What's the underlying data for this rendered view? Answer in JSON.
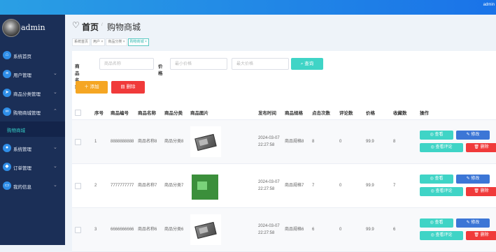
{
  "topbar": {
    "user": "admin"
  },
  "sidebar": {
    "brand": "admin",
    "items": [
      {
        "label": "系统首页",
        "icon": "home-icon",
        "chevron": false
      },
      {
        "label": "用户管理",
        "icon": "menu-list-icon",
        "chevron": true
      },
      {
        "label": "商品分类管理",
        "icon": "send-icon",
        "chevron": true
      },
      {
        "label": "购物商城管理",
        "icon": "link-icon",
        "chevron": true,
        "expanded": true
      },
      {
        "label": "系统管理",
        "icon": "person-icon",
        "chevron": true
      },
      {
        "label": "订单管理",
        "icon": "shield-icon",
        "chevron": true
      },
      {
        "label": "我的信息",
        "icon": "card-icon",
        "chevron": true
      }
    ],
    "sub_item": "购物商城"
  },
  "header": {
    "home": "首页",
    "separator": "/",
    "current": "购物商城"
  },
  "tags": [
    {
      "label": "系统首页",
      "active": false
    },
    {
      "label": "用户 ×",
      "active": false
    },
    {
      "label": "商品分类 ×",
      "active": false
    },
    {
      "label": "购物商城 ×",
      "active": true
    }
  ],
  "search": {
    "name_label": "商品名称",
    "name_placeholder": "商品名称",
    "price_label": "价格",
    "min_placeholder": "最小价格",
    "max_placeholder": "最大价格",
    "query_button": "查询"
  },
  "actions": {
    "add": "添加",
    "delete": "删除"
  },
  "table": {
    "headers": [
      "",
      "序号",
      "商品编号",
      "商品名称",
      "商品分类",
      "商品图片",
      "发布时间",
      "商品规格",
      "点击次数",
      "评论数",
      "价格",
      "收藏数",
      "操作"
    ],
    "rows": [
      {
        "index": "1",
        "code": "8888888888",
        "name": "商品名称8",
        "category": "商品分类8",
        "image": "chip",
        "time": "2024-03-07 22:27:58",
        "spec": "商品规格8",
        "clicks": "8",
        "comments": "0",
        "price": "99.9",
        "favorites": "8"
      },
      {
        "index": "2",
        "code": "7777777777",
        "name": "商品名称7",
        "category": "商品分类7",
        "image": "board",
        "time": "2024-03-07 22:27:58",
        "spec": "商品规格7",
        "clicks": "7",
        "comments": "0",
        "price": "99.9",
        "favorites": "7"
      },
      {
        "index": "3",
        "code": "6666666666",
        "name": "商品名称6",
        "category": "商品分类6",
        "image": "chip",
        "time": "2024-03-07 22:27:58",
        "spec": "商品规格6",
        "clicks": "6",
        "comments": "0",
        "price": "99.9",
        "favorites": "6"
      }
    ],
    "ops": {
      "view": "◎ 查看",
      "edit": "✎ 修改",
      "review": "◎ 查看评论",
      "delete": "🗑 删除"
    }
  }
}
